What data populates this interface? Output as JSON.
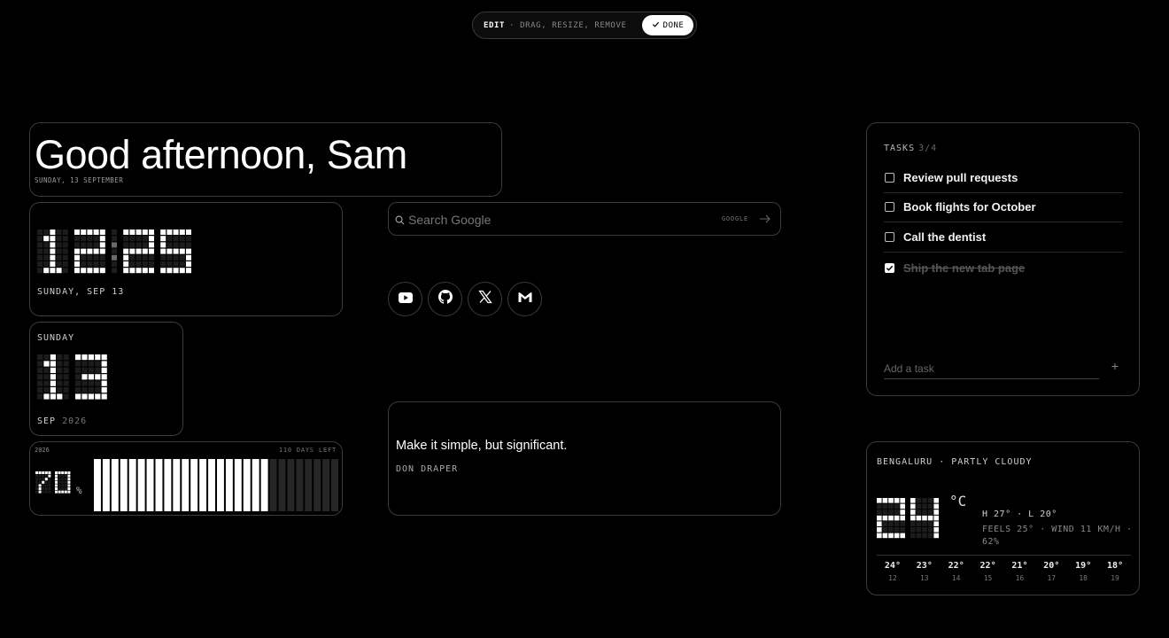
{
  "editbar": {
    "edit": "EDIT",
    "hint": "· DRAG, RESIZE, REMOVE",
    "done": "DONE"
  },
  "greeting": {
    "title": "Good afternoon, Sam",
    "subtitle": "SUNDAY, 13 SEPTEMBER"
  },
  "clock": {
    "hours": "12",
    "minutes": "25",
    "date": "SUNDAY, SEP 13"
  },
  "datecard": {
    "weekday": "SUNDAY",
    "day": "13",
    "month": "SEP",
    "year": "2026"
  },
  "yearprogress": {
    "year": "2026",
    "days_left": "110 DAYS LEFT",
    "percent": "70",
    "percent_sign": "%",
    "progress": 0.7,
    "segments": 28
  },
  "search": {
    "placeholder": "Search Google",
    "engine": "GOOGLE"
  },
  "shortcuts": [
    "youtube-icon",
    "github-icon",
    "x-icon",
    "gmail-icon"
  ],
  "quote": {
    "text": "Make it simple, but significant.",
    "author": "DON DRAPER"
  },
  "tasks": {
    "title": "TASKS",
    "count": "3/4",
    "items": [
      {
        "label": "Review pull requests",
        "done": false
      },
      {
        "label": "Book flights for October",
        "done": false
      },
      {
        "label": "Call the dentist",
        "done": false
      },
      {
        "label": "Ship the new tab page",
        "done": true
      }
    ],
    "add_placeholder": "Add a task",
    "add_symbol": "+"
  },
  "weather": {
    "location": "BENGALURU · PARTLY CLOUDY",
    "temp": "24",
    "unit": "°C",
    "high_low": "H 27° · L 20°",
    "details": "FEELS 25° · WIND 11 KM/H · 62%",
    "forecast": [
      {
        "temp": "24°",
        "day": "12"
      },
      {
        "temp": "23°",
        "day": "13"
      },
      {
        "temp": "22°",
        "day": "14"
      },
      {
        "temp": "22°",
        "day": "15"
      },
      {
        "temp": "21°",
        "day": "16"
      },
      {
        "temp": "20°",
        "day": "17"
      },
      {
        "temp": "19°",
        "day": "18"
      },
      {
        "temp": "18°",
        "day": "19"
      }
    ]
  }
}
